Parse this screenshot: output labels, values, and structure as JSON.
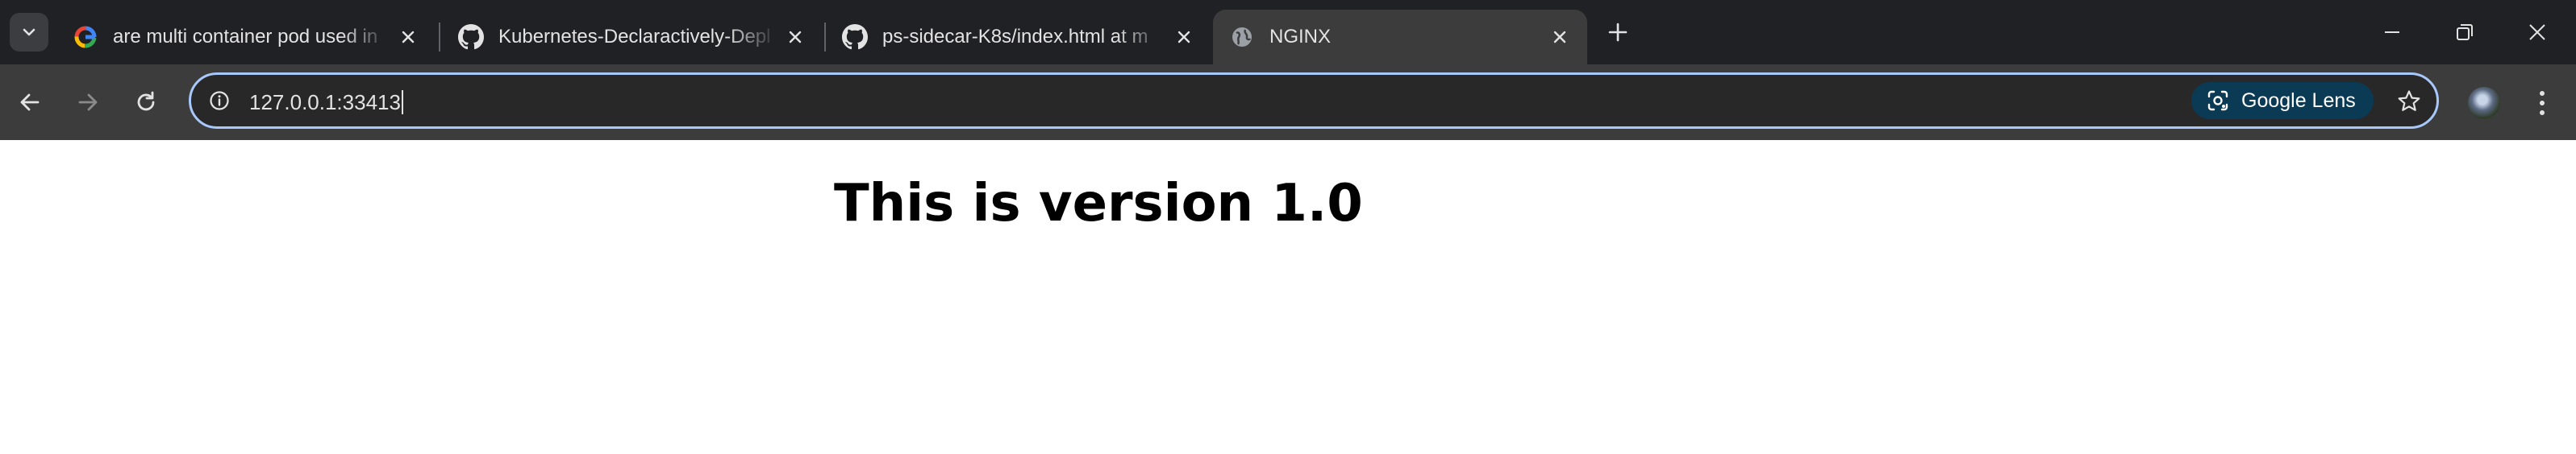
{
  "tabs": [
    {
      "title": "are multi container pod used in",
      "favicon": "google-icon",
      "active": false
    },
    {
      "title": "Kubernetes-Declaractively-Depl",
      "favicon": "github-icon",
      "active": false
    },
    {
      "title": "ps-sidecar-K8s/index.html at m",
      "favicon": "github-icon",
      "active": false
    },
    {
      "title": "NGINX",
      "favicon": "globe-icon",
      "active": true
    }
  ],
  "address_bar": {
    "url": "127.0.0.1:33413",
    "lens_label": "Google Lens"
  },
  "page": {
    "heading": "This is version 1.0"
  },
  "colors": {
    "tabstrip": "#202124",
    "toolbar": "#3c3c3c",
    "omnibox_border": "#a8c7fa",
    "lens_chip": "#0b3a55"
  }
}
